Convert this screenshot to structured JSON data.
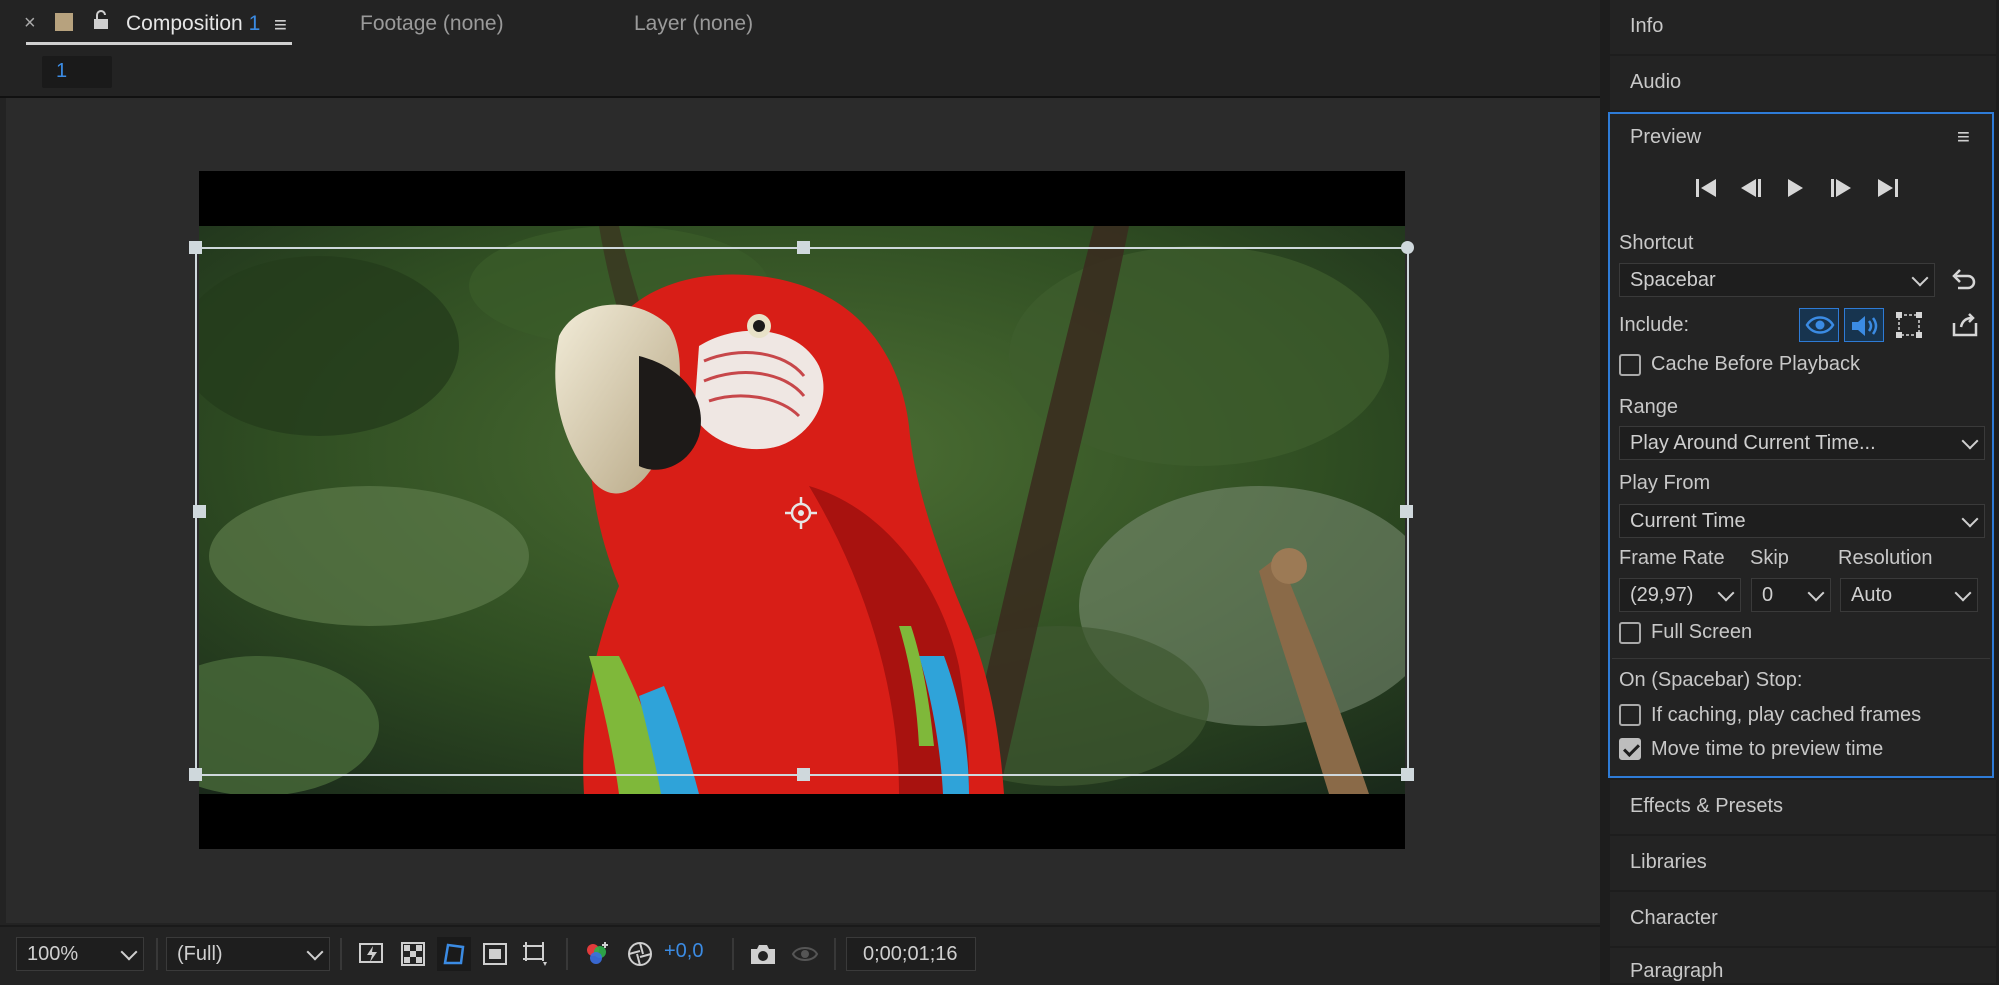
{
  "comp_tabs": {
    "composition_label": "Composition",
    "composition_num": "1",
    "footage": "Footage (none)",
    "layer": "Layer (none)",
    "flow_label": "1"
  },
  "bottom": {
    "zoom": "100%",
    "resolution": "(Full)",
    "exposure": "+0,0",
    "timecode": "0;00;01;16"
  },
  "panels": {
    "info": "Info",
    "audio": "Audio",
    "preview": "Preview",
    "effects": "Effects & Presets",
    "libraries": "Libraries",
    "character": "Character",
    "paragraph": "Paragraph"
  },
  "preview": {
    "shortcut_label": "Shortcut",
    "shortcut_value": "Spacebar",
    "include_label": "Include:",
    "cache_before": "Cache Before Playback",
    "range_label": "Range",
    "range_value": "Play Around Current Time...",
    "play_from_label": "Play From",
    "play_from_value": "Current Time",
    "frame_rate_label": "Frame Rate",
    "frame_rate_value": "(29,97)",
    "skip_label": "Skip",
    "skip_value": "0",
    "resolution_label": "Resolution",
    "resolution_value": "Auto",
    "full_screen": "Full Screen",
    "on_stop_label": "On (Spacebar) Stop:",
    "if_caching": "If caching, play cached frames",
    "move_time": "Move time to preview time",
    "cache_before_checked": false,
    "full_screen_checked": false,
    "if_caching_checked": false,
    "move_time_checked": true
  },
  "colors": {
    "accent": "#2e7bd6",
    "parrot_red": "#d81e17",
    "background": "#232323"
  }
}
